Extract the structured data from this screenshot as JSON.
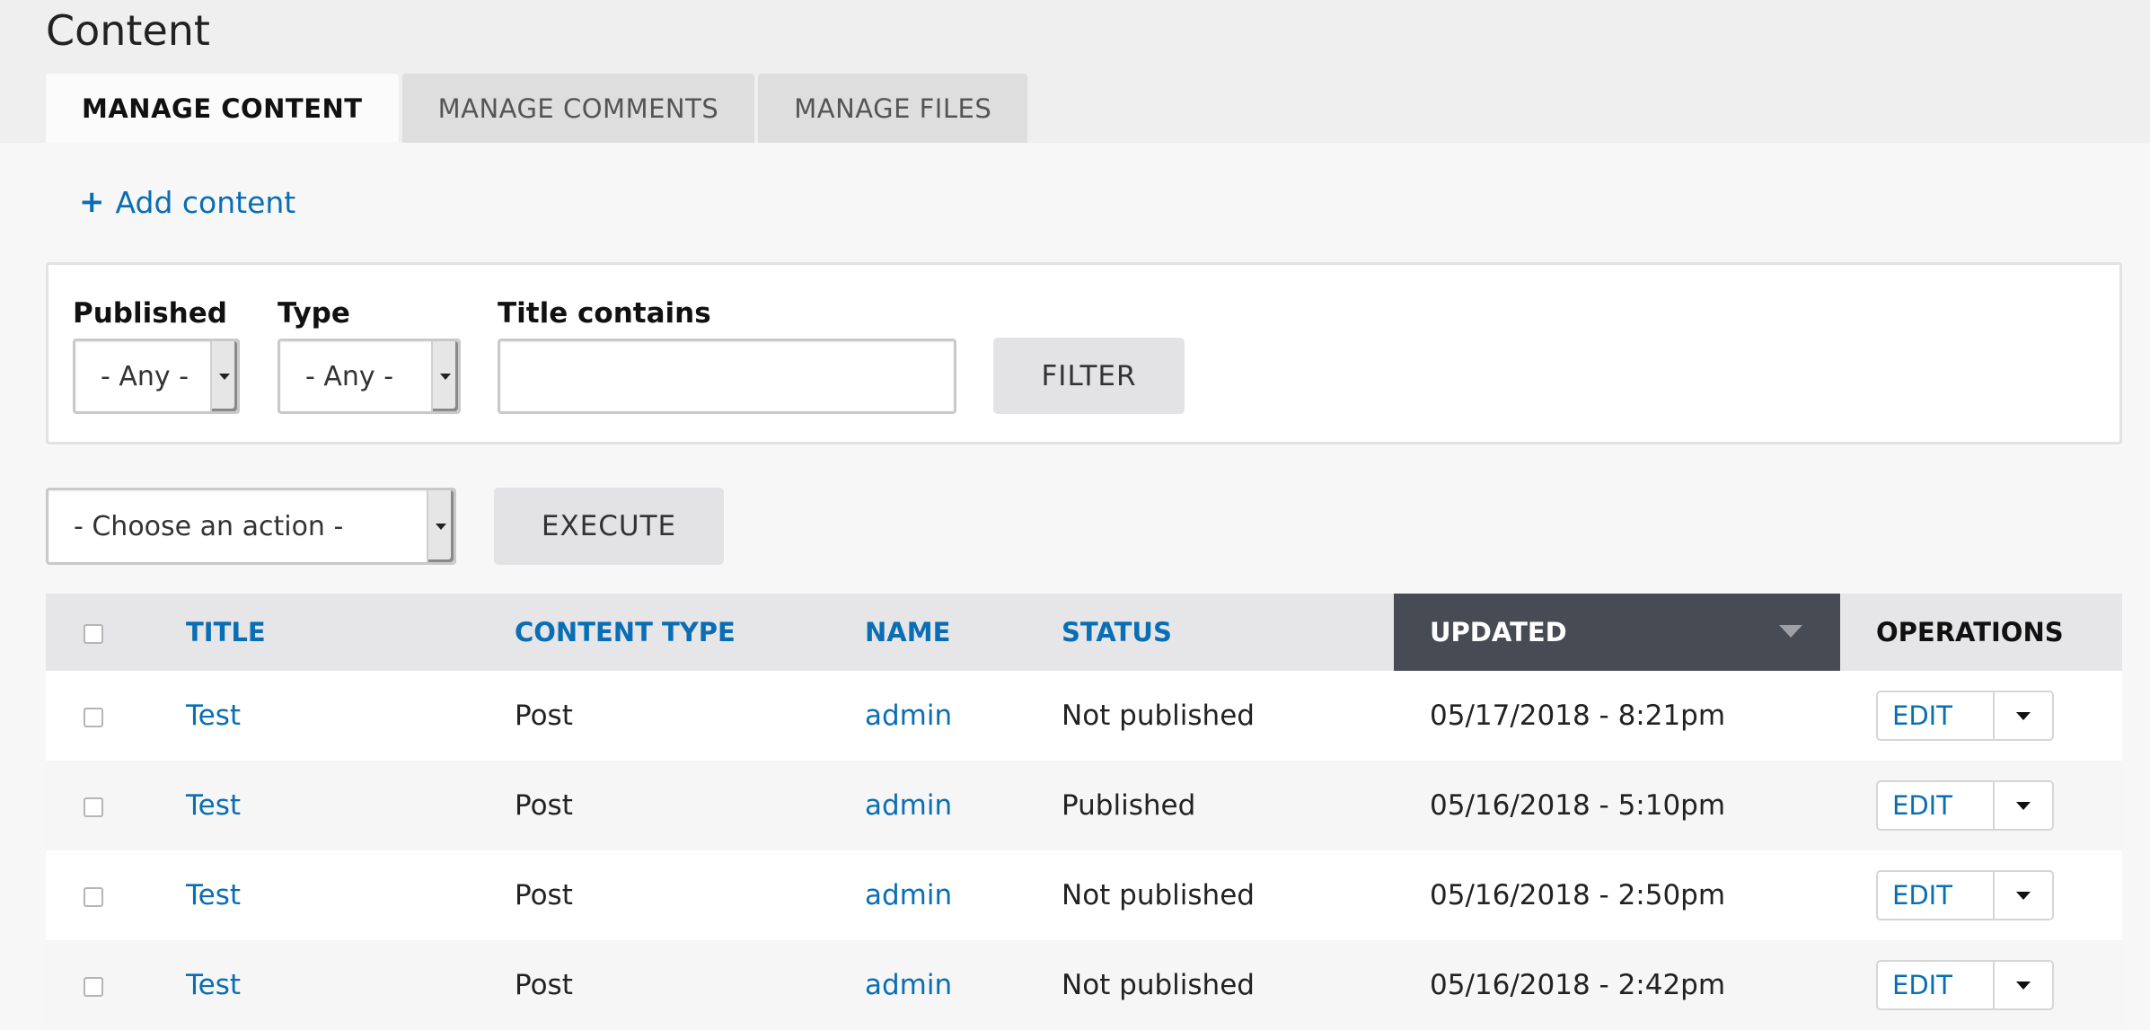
{
  "page": {
    "title": "Content"
  },
  "tabs": [
    {
      "label": "MANAGE CONTENT",
      "active": true
    },
    {
      "label": "MANAGE COMMENTS",
      "active": false
    },
    {
      "label": "MANAGE FILES",
      "active": false
    }
  ],
  "add_content": {
    "icon": "+",
    "label": "Add content"
  },
  "filters": {
    "published": {
      "label": "Published",
      "value": "- Any -"
    },
    "type": {
      "label": "Type",
      "value": "- Any -"
    },
    "title_contains": {
      "label": "Title contains",
      "value": "",
      "placeholder": ""
    },
    "filter_button": "FILTER"
  },
  "bulk": {
    "action_value": "- Choose an action -",
    "execute_button": "EXECUTE"
  },
  "table": {
    "columns": {
      "title": "TITLE",
      "content_type": "CONTENT TYPE",
      "name": "NAME",
      "status": "STATUS",
      "updated": "UPDATED",
      "operations": "OPERATIONS"
    },
    "sorted_column": "updated",
    "rows": [
      {
        "title": "Test",
        "content_type": "Post",
        "name": "admin",
        "status": "Not published",
        "updated": "05/17/2018 - 8:21pm",
        "edit": "EDIT"
      },
      {
        "title": "Test",
        "content_type": "Post",
        "name": "admin",
        "status": "Published",
        "updated": "05/16/2018 - 5:10pm",
        "edit": "EDIT"
      },
      {
        "title": "Test",
        "content_type": "Post",
        "name": "admin",
        "status": "Not published",
        "updated": "05/16/2018 - 2:50pm",
        "edit": "EDIT"
      },
      {
        "title": "Test",
        "content_type": "Post",
        "name": "admin",
        "status": "Not published",
        "updated": "05/16/2018 - 2:42pm",
        "edit": "EDIT"
      }
    ]
  },
  "colors": {
    "link": "#0a6eb4",
    "sorted_header_bg": "#474b53",
    "header_bg": "#e6e6e8",
    "tab_inactive_bg": "#dedede"
  }
}
